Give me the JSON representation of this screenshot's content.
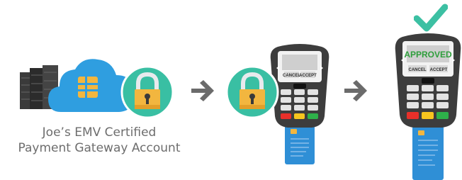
{
  "caption": {
    "line1": "Joe’s EMV Certified",
    "line2": "Payment Gateway Account"
  },
  "terminal_middle": {
    "cancel_label": "CANCEL",
    "accept_label": "ACCEPT",
    "screen_text": ""
  },
  "terminal_right": {
    "cancel_label": "CANCEL",
    "accept_label": "ACCEPT",
    "screen_text": "APPROVED"
  },
  "icons": {
    "server": "server-stack-icon",
    "cloud": "cloud-emv-chip-icon",
    "lock": "padlock-icon",
    "arrow": "arrow-right-icon",
    "check": "checkmark-icon",
    "card": "credit-card-icon"
  },
  "colors": {
    "cloud": "#2f9ee0",
    "lock_circle": "#39bfa3",
    "lock_body": "#f2b63f",
    "check": "#3cc0a3",
    "arrow": "#6b6b6b",
    "card": "#2f8fd6",
    "key_red": "#e8302a",
    "key_yellow": "#f7c51e",
    "key_green": "#2eb14a"
  }
}
